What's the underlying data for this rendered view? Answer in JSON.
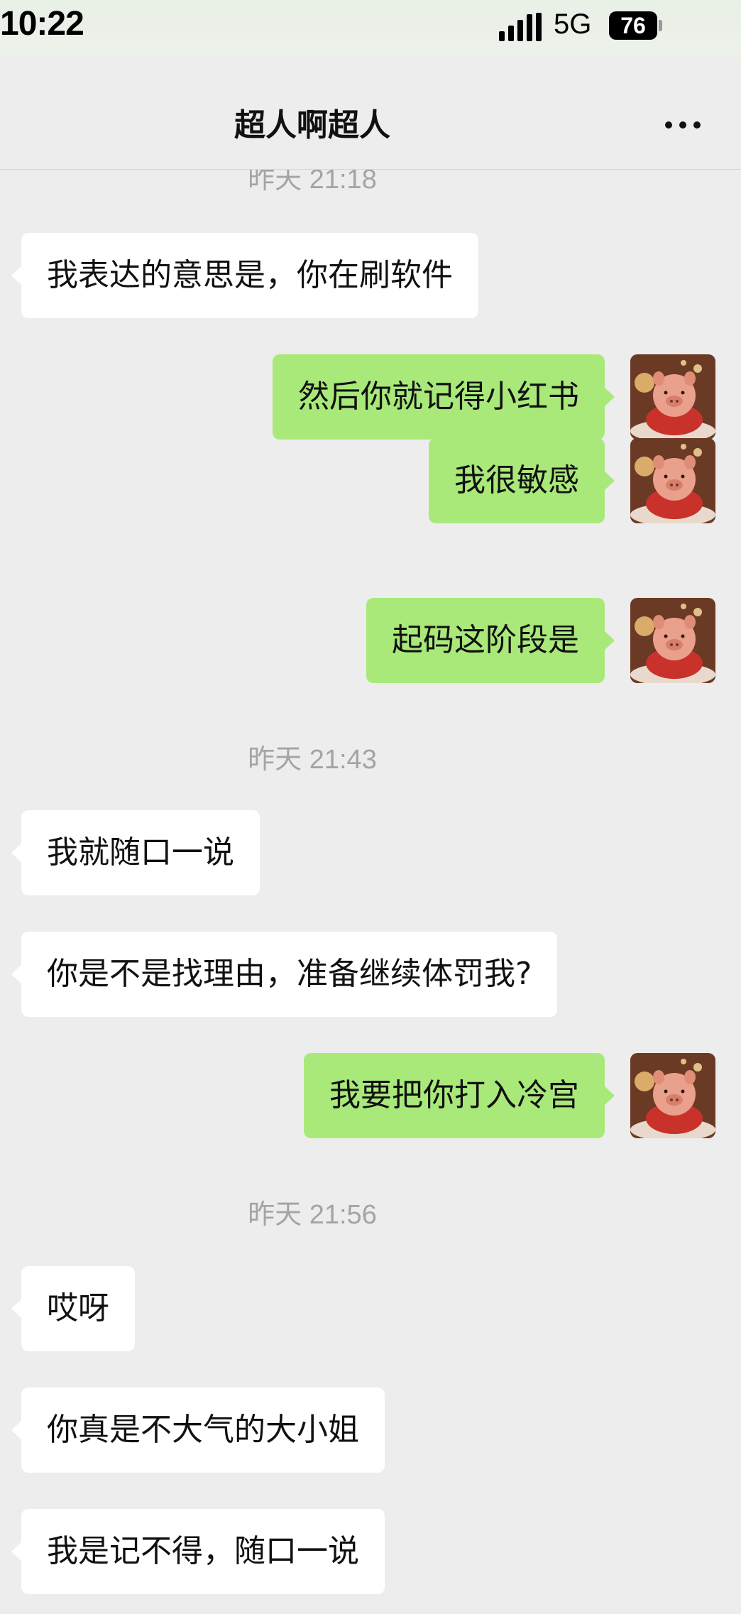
{
  "status_bar": {
    "time": "10:22",
    "network": "5G",
    "battery": "76"
  },
  "header": {
    "title": "超人啊超人",
    "more_icon": "more-dots-icon"
  },
  "timestamps": [
    "昨天 21:18",
    "昨天 21:43",
    "昨天 21:56"
  ],
  "messages": [
    {
      "side": "in",
      "text": "我表达的意思是，你在刷软件"
    },
    {
      "side": "out",
      "text": "然后你就记得小红书"
    },
    {
      "side": "out",
      "text": "我很敏感"
    },
    {
      "side": "out",
      "text": "起码这阶段是"
    },
    {
      "side": "in",
      "text": "我就随口一说"
    },
    {
      "side": "in",
      "text": "你是不是找理由，准备继续体罚我?"
    },
    {
      "side": "out",
      "text": "我要把你打入冷宫"
    },
    {
      "side": "in",
      "text": "哎呀"
    },
    {
      "side": "in",
      "text": "你真是不大气的大小姐"
    },
    {
      "side": "in",
      "text": "我是记不得，随口一说"
    }
  ],
  "colors": {
    "outgoing_bubble": "#a9e97a",
    "incoming_bubble": "#ffffff",
    "background": "#ededed",
    "timestamp": "#a4a4a4"
  }
}
